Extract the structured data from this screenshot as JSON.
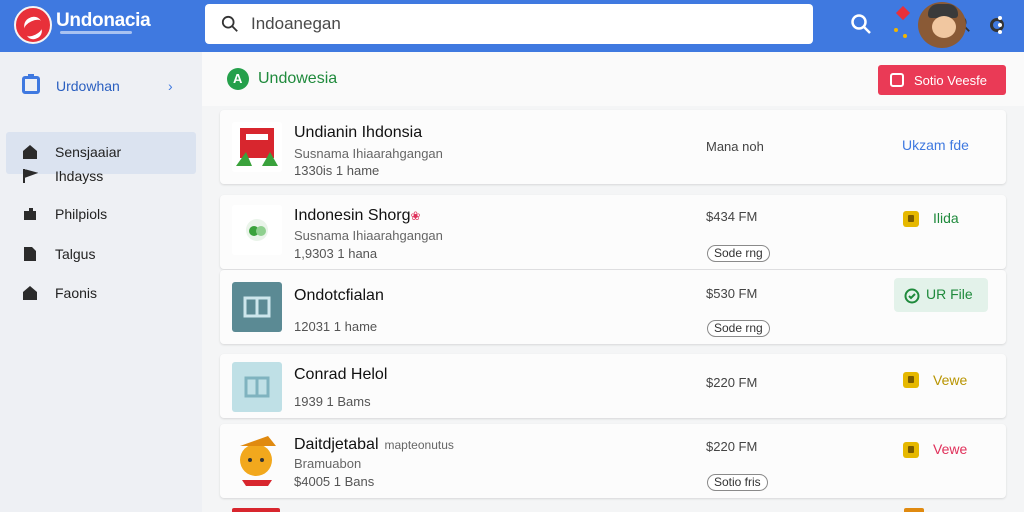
{
  "app": {
    "brand": "Undonacia",
    "colors": {
      "topbar": "#3f79e0",
      "logo": "#e8303a",
      "green": "#25a04b",
      "cta": "#ea3a56",
      "action_yellow": "#e6b800"
    }
  },
  "search": {
    "value": "Indoanegan",
    "icons": [
      "search-icon",
      "search-icon",
      "mic-icon"
    ]
  },
  "topbar": {
    "icons": [
      "search-icon",
      "badge-icon",
      "avatar",
      "more-vertical-icon"
    ]
  },
  "sidebar": {
    "header": {
      "label": "Urdowhan",
      "icon": "folder-icon",
      "chevron": "›"
    },
    "items": [
      {
        "label": "Sensjaaiar",
        "icon": "home-icon"
      },
      {
        "label": "Ihdayss",
        "icon": "flag-icon"
      },
      {
        "label": "Philpiols",
        "icon": "puzzle-icon"
      },
      {
        "label": "Talgus",
        "icon": "file-icon"
      },
      {
        "label": "Faonis",
        "icon": "home-icon"
      }
    ]
  },
  "main": {
    "title": "Undowesia",
    "cta_label": "Sotio Veesfe"
  },
  "rows": [
    {
      "title": "Undianin Ihdonsia",
      "subtitle": "Susnama Ihiaarahgangan",
      "meta": "1330is 1 hame",
      "price": "Mana noh",
      "pill": "",
      "action": "Ukzam fde",
      "action_color": "#3f79e0"
    },
    {
      "title": "Indonesin Shorg",
      "subtitle": "Susnama Ihiaarahgangan",
      "meta": "1,9303 1 hana",
      "price": "$434 FM",
      "pill": "Sode rng",
      "action": "Ilida",
      "action_color": "#1f8a3c"
    },
    {
      "title": "Ondotcfialan",
      "subtitle": "",
      "meta": "12031 1 hame",
      "price": "$530 FM",
      "pill": "Sode rng",
      "action": "UR File",
      "action_color": "#1f8a3c"
    },
    {
      "title": "Conrad Helol",
      "subtitle": "",
      "meta": "1939 1 Bams",
      "price": "$220 FM",
      "pill": "",
      "action": "Vewe",
      "action_color": "#b89400"
    },
    {
      "title": "Daitdjetabal",
      "title_tag": "mapteonutus",
      "subtitle": "Bramuabon",
      "meta": "$4005 1 Bans",
      "price": "$220 FM",
      "pill": "Sotio fris",
      "action": "Vewe",
      "action_color": "#e0305a"
    }
  ]
}
